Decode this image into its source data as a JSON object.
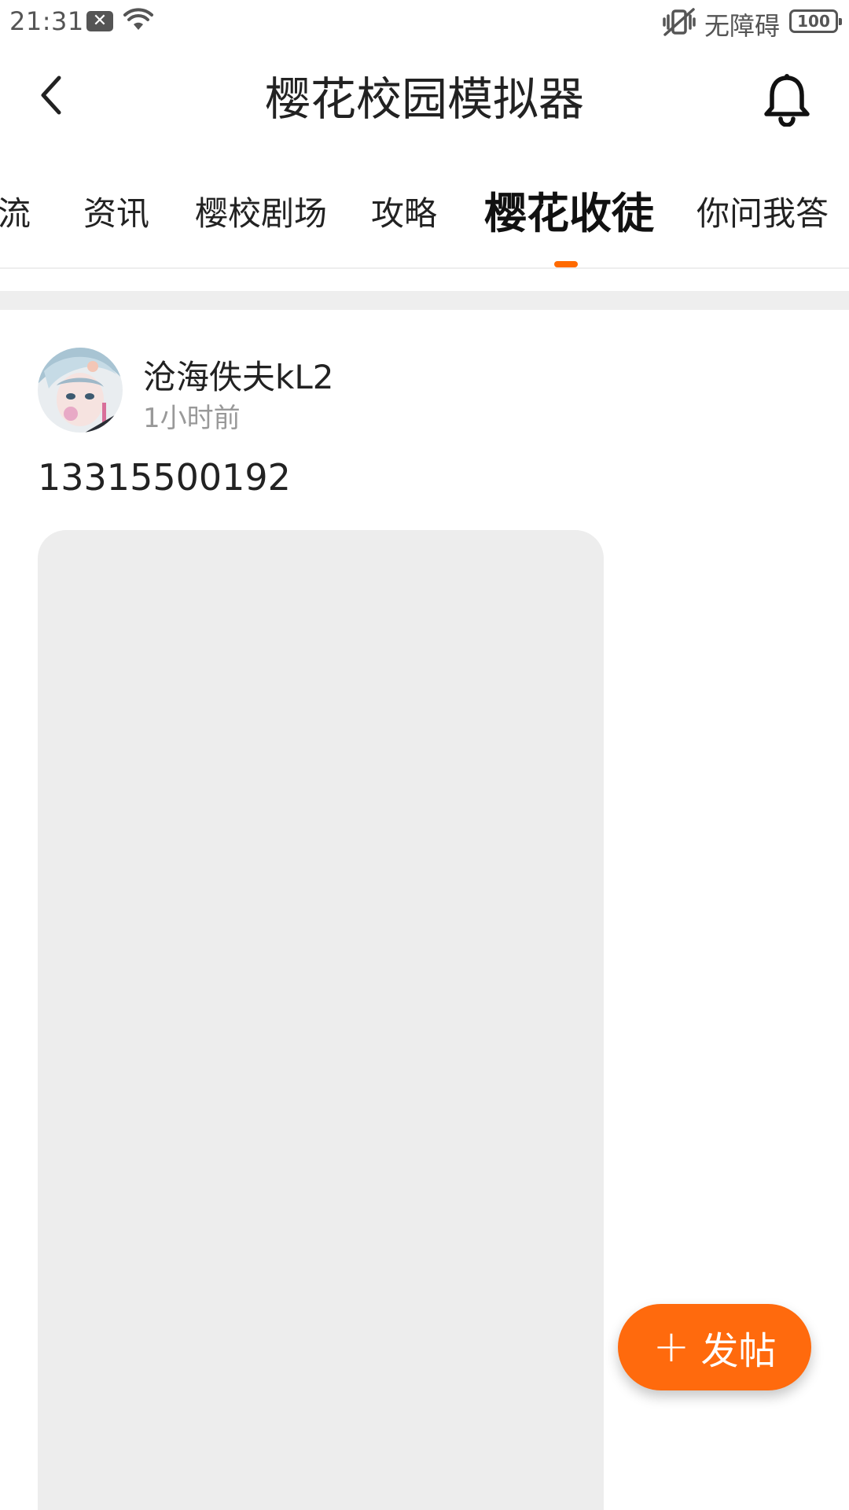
{
  "status_bar": {
    "time": "21:31",
    "notification_badge": "✕",
    "accessibility": "无障碍",
    "battery": "100"
  },
  "header": {
    "title": "樱花校园模拟器"
  },
  "tabs": [
    {
      "label": "交流",
      "active": false
    },
    {
      "label": "资讯",
      "active": false
    },
    {
      "label": "樱校剧场",
      "active": false
    },
    {
      "label": "攻略",
      "active": false
    },
    {
      "label": "樱花收徒",
      "active": true
    },
    {
      "label": "你问我答",
      "active": false
    }
  ],
  "post": {
    "author": "沧海佚夫kL2",
    "time": "1小时前",
    "text": "13315500192"
  },
  "fab": {
    "label": "发帖"
  },
  "colors": {
    "accent": "#ff6a00",
    "placeholder": "#ededed"
  },
  "icons": [
    "back-arrow-icon",
    "bell-icon",
    "plus-icon",
    "wifi-icon",
    "vibrate-icon"
  ]
}
